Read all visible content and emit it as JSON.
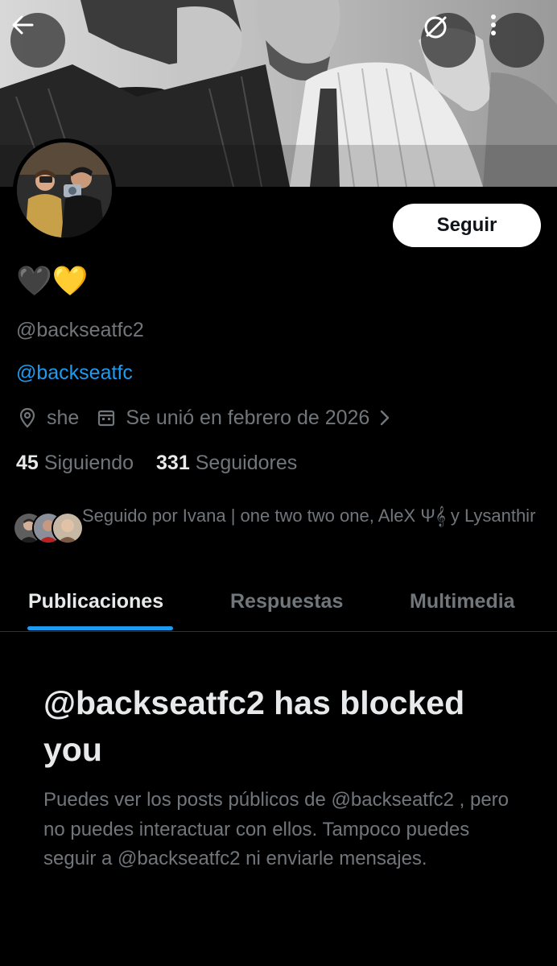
{
  "header": {
    "back_icon": "arrow-left-icon",
    "translate_icon": "translate-off-icon",
    "more_icon": "more-vertical-icon"
  },
  "profile": {
    "display_name_hearts": [
      "🖤",
      "💛"
    ],
    "follow_button_label": "Seguir",
    "handle": "@backseatfc2",
    "bio_link": "@backseatfc",
    "location": "she",
    "joined": "Se unió en febrero de 2026",
    "following_count": "45",
    "following_label": "Siguiendo",
    "followers_count": "331",
    "followers_label": "Seguidores",
    "followed_by_text": "Seguido por Ivana | one two two one, AleX Ψ𝄞 y Lysanthir"
  },
  "tabs": [
    {
      "label": "Publicaciones",
      "active": true
    },
    {
      "label": "Respuestas",
      "active": false
    },
    {
      "label": "Multimedia",
      "active": false
    }
  ],
  "blocked": {
    "title": "@backseatfc2 has blocked you",
    "description": "Puedes ver los posts públicos de @backseatfc2 , pero no puedes interactuar con ellos. Tampoco puedes seguir a @backseatfc2 ni enviarle mensajes."
  },
  "colors": {
    "background": "#000000",
    "accent": "#1d9bf0",
    "secondary_text": "#71767b",
    "primary_text": "#e7e9ea"
  }
}
